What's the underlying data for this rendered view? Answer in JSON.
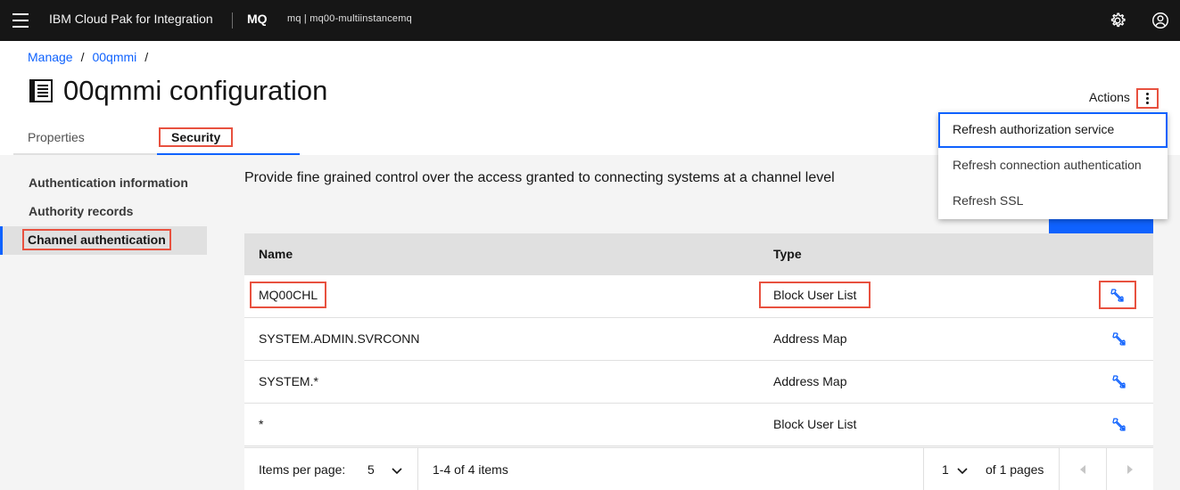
{
  "header": {
    "brand": "IBM Cloud Pak for Integration",
    "product": "MQ",
    "instance": "mq | mq00-multiinstancemq",
    "icons": [
      "menu-icon",
      "settings-icon",
      "user-icon"
    ]
  },
  "breadcrumb": {
    "items": [
      "Manage",
      "00qmmi"
    ],
    "separator": "/"
  },
  "page": {
    "title": "00qmmi configuration"
  },
  "tabs": {
    "properties": "Properties",
    "security": "Security"
  },
  "sidenav": {
    "items": [
      "Authentication information",
      "Authority records",
      "Channel authentication"
    ],
    "active": "Channel authentication"
  },
  "content": {
    "description": "Provide fine grained control over the access granted to connecting systems at a channel level"
  },
  "table": {
    "headers": {
      "name": "Name",
      "type": "Type"
    },
    "rows": [
      {
        "name": "MQ00CHL",
        "type": "Block User List"
      },
      {
        "name": "SYSTEM.ADMIN.SVRCONN",
        "type": "Address Map"
      },
      {
        "name": "SYSTEM.*",
        "type": "Address Map"
      },
      {
        "name": "*",
        "type": "Block User List"
      }
    ]
  },
  "pagination": {
    "items_per_page_label": "Items per page:",
    "items_per_page": "5",
    "range": "1-4 of 4 items",
    "page": "1",
    "of_pages": "of 1 pages"
  },
  "actions": {
    "label": "Actions",
    "menu": [
      "Refresh authorization service",
      "Refresh connection authentication",
      "Refresh SSL"
    ]
  },
  "colors": {
    "accent": "#0f62fe",
    "highlight": "#e8513f",
    "header_bg": "#161616"
  }
}
